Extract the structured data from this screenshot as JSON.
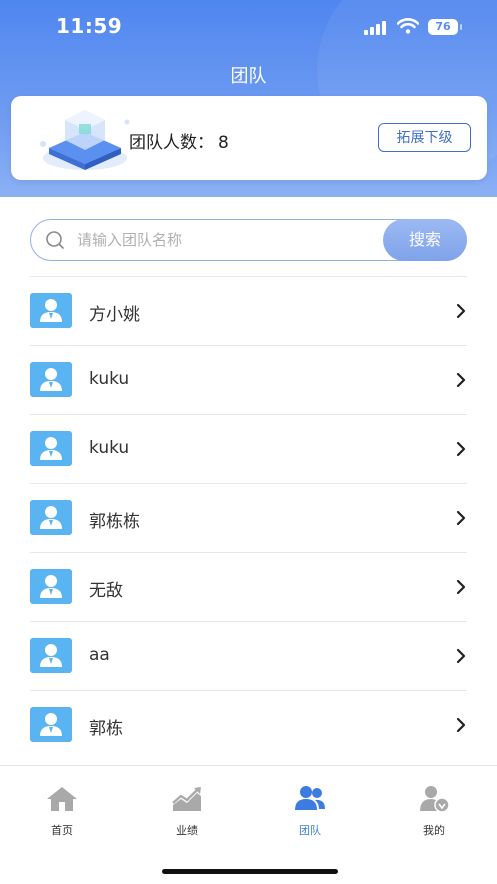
{
  "status_bar": {
    "time": "11:59",
    "battery": "76"
  },
  "header": {
    "title": "团队"
  },
  "team_card": {
    "count_label": "团队人数：",
    "count": "8",
    "expand_button": "拓展下级"
  },
  "search": {
    "placeholder": "请输入团队名称",
    "value": "",
    "button": "搜索"
  },
  "members": [
    {
      "name": "方小姚"
    },
    {
      "name": "kuku"
    },
    {
      "name": "kuku"
    },
    {
      "name": "郭栋栋"
    },
    {
      "name": "无敌"
    },
    {
      "name": "aa"
    },
    {
      "name": "郭栋"
    }
  ],
  "tabbar": {
    "tabs": [
      {
        "label": "首页",
        "icon": "home-icon"
      },
      {
        "label": "业绩",
        "icon": "performance-icon"
      },
      {
        "label": "团队",
        "icon": "team-icon",
        "active": true
      },
      {
        "label": "我的",
        "icon": "profile-icon"
      }
    ]
  },
  "colors": {
    "accent": "#4f86ef",
    "avatar": "#5ab4f2",
    "active_tab": "#3c7ce0",
    "inactive_icon": "#a9a9a9"
  }
}
